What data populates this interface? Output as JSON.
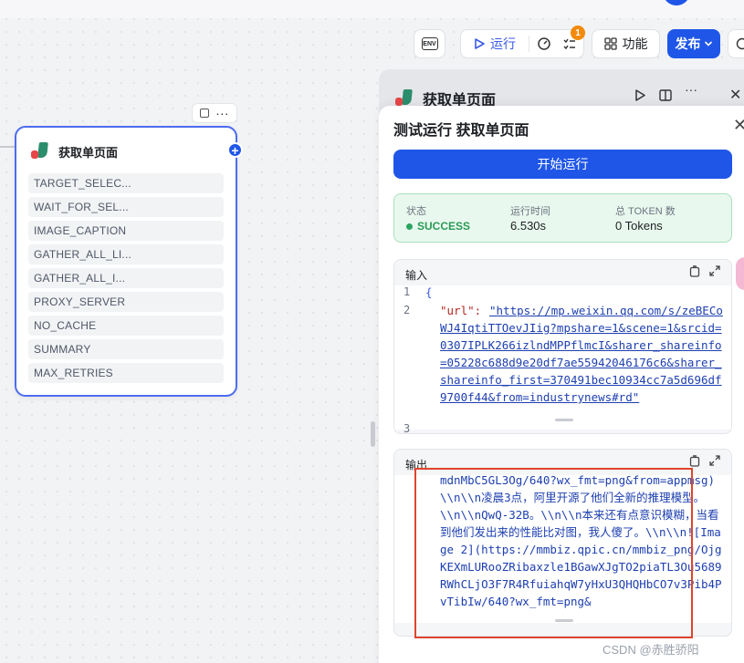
{
  "toolbar": {
    "env_label": "ENV",
    "run_label": "运行",
    "issues_badge": "1",
    "function_label": "功能",
    "publish_label": "发布"
  },
  "node": {
    "title": "获取单页面",
    "params": [
      "TARGET_SELEC...",
      "WAIT_FOR_SEL...",
      "IMAGE_CAPTION",
      "GATHER_ALL_LI...",
      "GATHER_ALL_I...",
      "PROXY_SERVER",
      "NO_CACHE",
      "SUMMARY",
      "MAX_RETRIES"
    ]
  },
  "drawer": {
    "title": "获取单页面"
  },
  "test_run": {
    "title": "测试运行 获取单页面",
    "start_button": "开始运行",
    "status_label": "状态",
    "status_value": "SUCCESS",
    "time_label": "运行时间",
    "time_value": "6.530s",
    "token_label": "总 TOKEN 数",
    "token_value": "0 Tokens",
    "input_label": "输入",
    "input_lines": [
      "1",
      "2",
      "3"
    ],
    "input_open": "{",
    "input_key": "\"url\": ",
    "input_url": "\"https://mp.weixin.qq.com/s/zeBECoWJ4IqtiTTOevJIig?mpshare=1&scene=1&srcid=0307IPLK266izlndMPPflmcI&sharer_shareinfo=05228c688d9e20df7ae55942046176c6&sharer_shareinfo_first=370491bec10934cc7a5d696df9700f44&from=industrynews#rd\"",
    "output_label": "输出",
    "output_text": "mdnMbC5GL3Og/640?wx_fmt=png&from=appmsg)\\\\n\\\\n凌晨3点，阿里开源了他们全新的推理模型。\\\\n\\\\nQwQ-32B。\\\\n\\\\n本来还有点意识模糊，当看到他们发出来的性能比对图，我人傻了。\\\\n\\\\n![Image 2](https://mmbiz.qpic.cn/mmbiz_png/OjgKEXmLURooZRibaxzle1BGawXJgTO2piaTL3Ou5689RWhCLjO3F7R4RfuiahqW7yHxU3QHQHbCO7v3Pib4PvTibIw/640?wx_fmt=png&"
  },
  "watermark": "CSDN @赤胜骄阳",
  "colors": {
    "accent": "#1f56e8",
    "success": "#2a9a55",
    "highlight": "#e0442c",
    "badge": "#f38a0b"
  }
}
